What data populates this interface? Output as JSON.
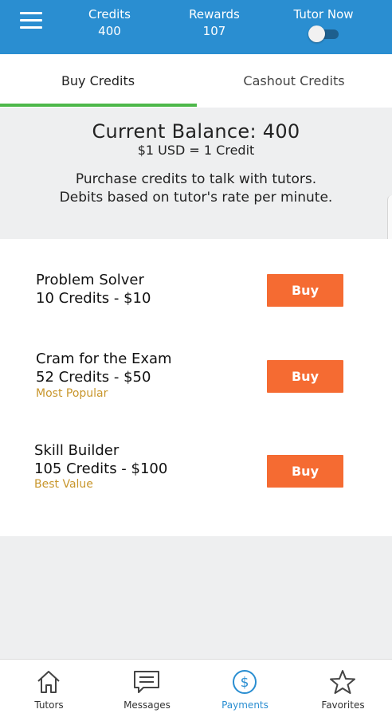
{
  "header": {
    "credits_label": "Credits",
    "credits_value": "400",
    "rewards_label": "Rewards",
    "rewards_value": "107",
    "tutor_now_label": "Tutor Now",
    "tutor_now_enabled": false
  },
  "tabs": [
    {
      "label": "Buy Credits",
      "active": true
    },
    {
      "label": "Cashout Credits",
      "active": false
    }
  ],
  "balance": {
    "title": "Current Balance: 400",
    "rate": "$1 USD = 1 Credit",
    "description_line1": "Purchase credits to talk with tutors.",
    "description_line2": "Debits based on tutor's rate per minute."
  },
  "packages": [
    {
      "name": "Problem Solver",
      "price": "10 Credits - $10",
      "tag": "",
      "button": "Buy"
    },
    {
      "name": "Cram for the Exam",
      "price": "52 Credits - $50",
      "tag": "Most Popular",
      "button": "Buy"
    },
    {
      "name": "Skill Builder",
      "price": "105 Credits - $100",
      "tag": "Best Value",
      "button": "Buy"
    }
  ],
  "bottom_nav": [
    {
      "label": "Tutors",
      "icon": "home-icon",
      "active": false
    },
    {
      "label": "Messages",
      "icon": "message-icon",
      "active": false
    },
    {
      "label": "Payments",
      "icon": "dollar-circle-icon",
      "active": true
    },
    {
      "label": "Favorites",
      "icon": "star-icon",
      "active": false
    }
  ],
  "colors": {
    "header_blue": "#2a8ed1",
    "tab_indicator_green": "#4db84a",
    "buy_button_orange": "#f56b32",
    "tag_gold": "#c8962c"
  }
}
